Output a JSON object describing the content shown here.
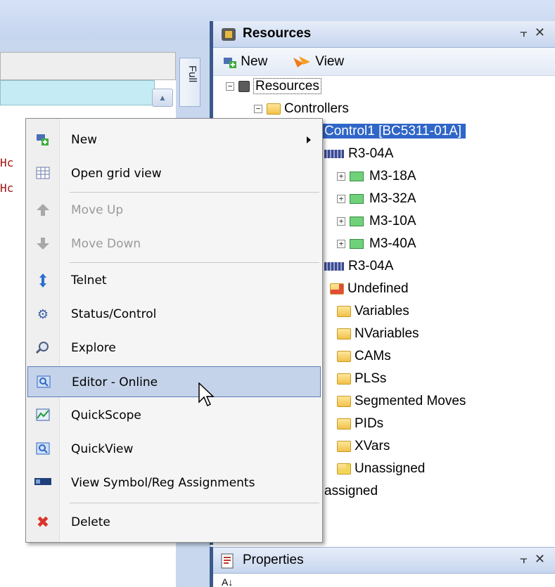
{
  "editor": {
    "full_tab_label": "Full",
    "code_lines": [
      "Hc",
      "Hc"
    ]
  },
  "resources_panel": {
    "title": "Resources",
    "toolbar": {
      "new_label": "New",
      "view_label": "View"
    },
    "tree": [
      {
        "label": "Resources"
      },
      {
        "label": "Controllers"
      },
      {
        "label": "Control1 [BC5311-01A]"
      },
      {
        "label": "R3-04A"
      },
      {
        "label": "M3-18A"
      },
      {
        "label": "M3-32A"
      },
      {
        "label": "M3-10A"
      },
      {
        "label": "M3-40A"
      },
      {
        "label": "R3-04A"
      },
      {
        "label": "Undefined"
      },
      {
        "label": "Variables"
      },
      {
        "label": "NVariables"
      },
      {
        "label": "CAMs"
      },
      {
        "label": "PLSs"
      },
      {
        "label": "Segmented Moves"
      },
      {
        "label": "PIDs"
      },
      {
        "label": "XVars"
      },
      {
        "label": "Unassigned"
      },
      {
        "label": "assigned"
      }
    ]
  },
  "properties_panel": {
    "title": "Properties",
    "toolbar_sort_label": "A↓"
  },
  "context_menu": {
    "items": [
      {
        "label": "New",
        "icon": "new-icon",
        "enabled": true,
        "submenu": true
      },
      {
        "label": "Open grid view",
        "icon": "grid-icon",
        "enabled": true
      },
      {
        "label": "Move Up",
        "icon": "arrow-up-icon",
        "enabled": false
      },
      {
        "label": "Move Down",
        "icon": "arrow-down-icon",
        "enabled": false
      },
      {
        "label": "Telnet",
        "icon": "telnet-icon",
        "enabled": true
      },
      {
        "label": "Status/Control",
        "icon": "gear-icon",
        "enabled": true
      },
      {
        "label": "Explore",
        "icon": "explore-icon",
        "enabled": true
      },
      {
        "label": "Editor - Online",
        "icon": "editor-icon",
        "enabled": true,
        "highlighted": true
      },
      {
        "label": "QuickScope",
        "icon": "scope-icon",
        "enabled": true
      },
      {
        "label": "QuickView",
        "icon": "quickview-icon",
        "enabled": true
      },
      {
        "label": "View Symbol/Reg Assignments",
        "icon": "assignments-icon",
        "enabled": true
      },
      {
        "label": "Delete",
        "icon": "delete-icon",
        "enabled": true
      }
    ]
  },
  "colors": {
    "selection": "#2f66c8",
    "menu_highlight": "#c5d3ea",
    "panel_accent": "#3b5a8c"
  }
}
